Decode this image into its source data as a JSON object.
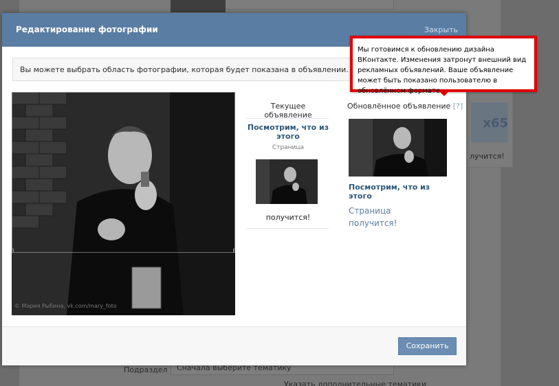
{
  "background": {
    "card_text_big": "x65",
    "card_text": "лучится!",
    "row_label": "Подраздел",
    "row_select": "Сначала выберите тематику",
    "row_link": "Указать дополнительные тематики"
  },
  "modal": {
    "title": "Редактирование фотографии",
    "close_label": "Закрыть",
    "info_text": "Вы можете выбрать область фотографии, которая будет показана в объявлении.",
    "watermark": "© Мария Рыбина, vk.com/mary_foto",
    "save_label": "Сохранить"
  },
  "current_ad": {
    "header": "Текущее объявление",
    "title": "Посмотрим, что из этого",
    "subtitle": "Страница",
    "text": "получится!"
  },
  "new_ad": {
    "header": "Обновлённое объявление",
    "help": "[?]",
    "title": "Посмотрим, что из этого",
    "subtitle": "Страница",
    "text": "получится!"
  },
  "tooltip": {
    "text": "Мы готовимся к обновлению дизайна ВКонтакте. Изменения затронут внешний вид рекламных объявлений. Ваше объявление может быть показано пользователю в обновлённом формате."
  },
  "colors": {
    "header": "#597da3",
    "link": "#2b587a",
    "button": "#6b8db3",
    "tooltip_border": "#e00000"
  },
  "icons": [
    "help-icon"
  ]
}
